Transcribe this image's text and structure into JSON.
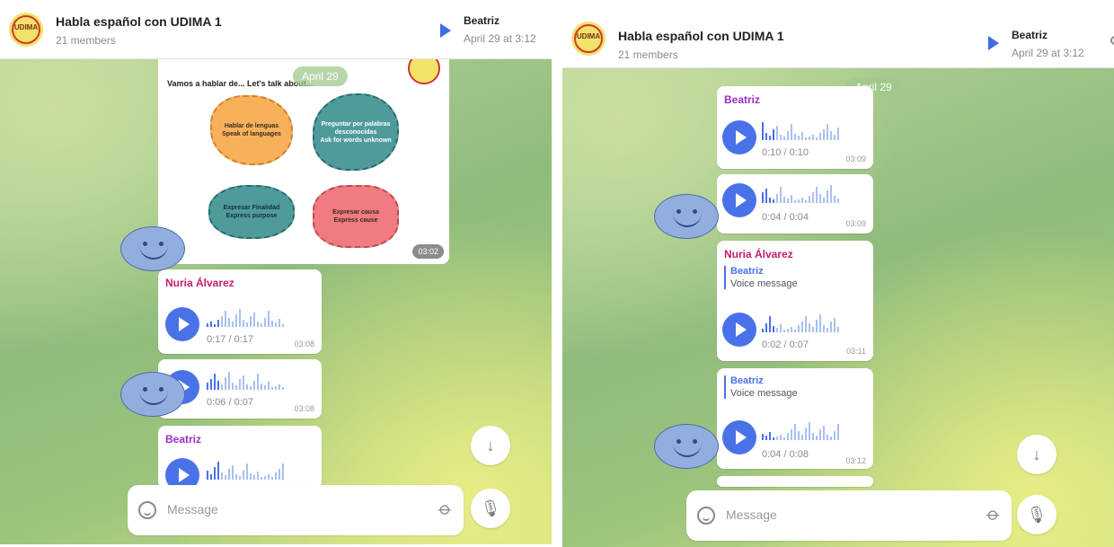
{
  "colors": {
    "accent": "#4a72e8",
    "sender_pink": "#c41e6b",
    "sender_purple": "#9a2fc4"
  },
  "left": {
    "header": {
      "title": "Habla español con UDIMA 1",
      "subtitle": "21 members",
      "pinned_name": "Beatriz",
      "pinned_date": "April 29 at 3:12"
    },
    "date_pill": "April 29",
    "image": {
      "heading": "Vamos a hablar de...   Let's talk about...",
      "bubble_1": "Hablar de lenguas\nSpeak of languages",
      "bubble_2": "Preguntar por palabras desconocidas\nAsk for words unknown",
      "bubble_3": "Expresar Finalidad\nExpress purpose",
      "bubble_4": "Expresar causa\nExpress cause",
      "time": "03:02"
    },
    "messages": [
      {
        "sender": "Nuria Álvarez",
        "duration": "0:17 / 0:17",
        "time": "03:08"
      },
      {
        "duration": "0:06 / 0:07",
        "time": "03:08"
      },
      {
        "sender": "Beatriz"
      }
    ],
    "composer": {
      "placeholder": "Message"
    }
  },
  "right": {
    "header": {
      "title": "Habla español con UDIMA 1",
      "subtitle": "21 members",
      "pinned_name": "Beatriz",
      "pinned_date": "April 29 at 3:12"
    },
    "date_pill": "April 29",
    "messages": [
      {
        "sender": "Beatriz",
        "duration": "0:10 / 0:10",
        "time": "03:09"
      },
      {
        "duration": "0:04 / 0:04",
        "time": "03:09"
      },
      {
        "sender": "Nuria Álvarez",
        "reply_name": "Beatriz",
        "reply_text": "Voice message",
        "duration": "0:02 / 0:07",
        "time": "03:11"
      },
      {
        "reply_name": "Beatriz",
        "reply_text": "Voice message",
        "duration": "0:04 / 0:08",
        "time": "03:12"
      }
    ],
    "composer": {
      "placeholder": "Message"
    }
  },
  "icons": {
    "play": "play-icon",
    "emoji": "smile-icon",
    "attach": "paperclip-icon",
    "mic": "microphone-icon",
    "scroll_down": "arrow-down-icon"
  }
}
